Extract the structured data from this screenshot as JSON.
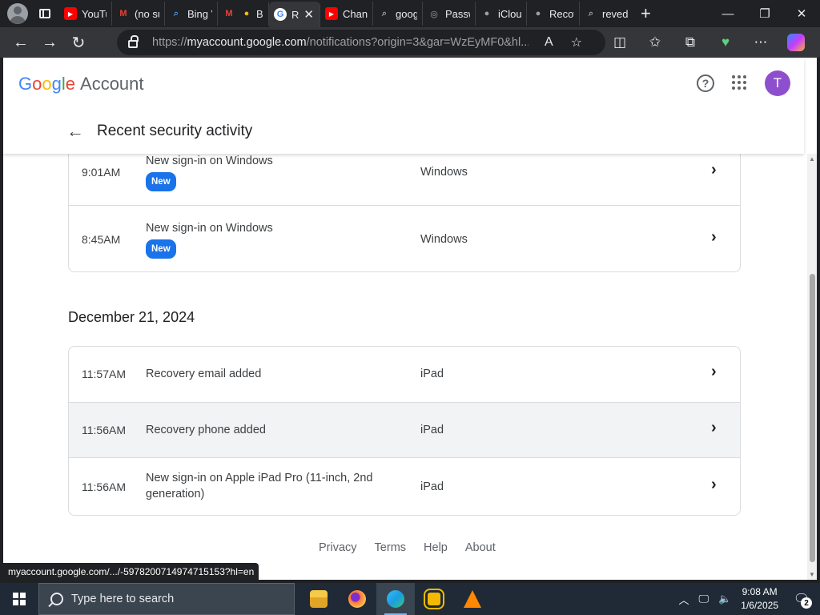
{
  "browser": {
    "tabs": [
      {
        "label": "YouTu",
        "icon": "youtube-icon",
        "color": "#ff0000"
      },
      {
        "label": "(no su",
        "icon": "gmail-icon",
        "color": "#ea4335"
      },
      {
        "label": "Bing V",
        "icon": "bing-search-icon",
        "color": "#4a90e2"
      },
      {
        "label": "Bu",
        "icon": "lightbulb-icon",
        "color": "#fbbc05"
      },
      {
        "label": "R",
        "icon": "google-icon",
        "color": "#ffffff",
        "active": true
      },
      {
        "label": "Chann",
        "icon": "youtube-icon",
        "color": "#ff0000"
      },
      {
        "label": "googl",
        "icon": "search-icon",
        "color": "#9aa0a6"
      },
      {
        "label": "Passw",
        "icon": "password-icon",
        "color": "#9aa0a6"
      },
      {
        "label": "iCloud",
        "icon": "apple-icon",
        "color": "#9aa0a6"
      },
      {
        "label": "Recov",
        "icon": "apple-icon",
        "color": "#9aa0a6"
      },
      {
        "label": "reved",
        "icon": "search-icon",
        "color": "#9aa0a6"
      }
    ],
    "url_prefix": "https://",
    "url_host": "myaccount.google.com",
    "url_path": "/notifications?origin=3&gar=WzEyMF0&hl..."
  },
  "header": {
    "logo_letters": [
      "G",
      "o",
      "o",
      "g",
      "l",
      "e"
    ],
    "product": "Account",
    "avatar_initial": "T",
    "page_title": "Recent security activity"
  },
  "activity": {
    "group1": [
      {
        "time": "9:01AM",
        "event": "New sign-in on Windows",
        "badge": "New",
        "device": "Windows"
      },
      {
        "time": "8:45AM",
        "event": "New sign-in on Windows",
        "badge": "New",
        "device": "Windows"
      }
    ],
    "date2": "December 21, 2024",
    "group2": [
      {
        "time": "11:57AM",
        "event": "Recovery email added",
        "device": "iPad"
      },
      {
        "time": "11:56AM",
        "event": "Recovery phone added",
        "device": "iPad"
      },
      {
        "time": "11:56AM",
        "event": "New sign-in on Apple iPad Pro (11-inch, 2nd generation)",
        "device": "iPad"
      }
    ]
  },
  "footer": {
    "privacy": "Privacy",
    "terms": "Terms",
    "help": "Help",
    "about": "About"
  },
  "status_url": "myaccount.google.com/.../-5978200714974715153?hl=en",
  "taskbar": {
    "search_placeholder": "Type here to search",
    "time": "9:08 AM",
    "date": "1/6/2025",
    "notifications": "2"
  }
}
